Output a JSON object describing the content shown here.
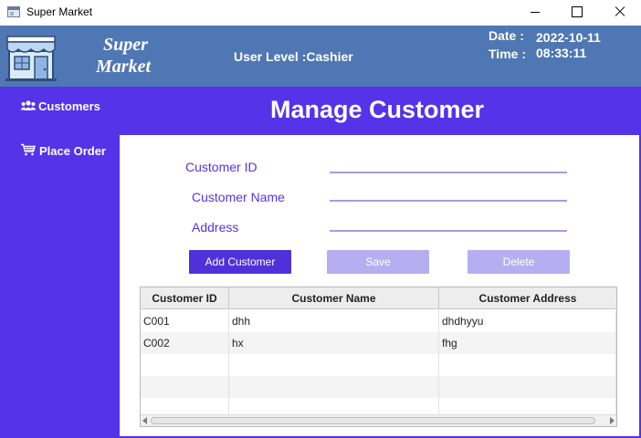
{
  "window": {
    "title": "Super Market"
  },
  "header": {
    "brand_line1": "Super",
    "brand_line2": "Market",
    "user_level": "User Level :Cashier",
    "date_label": "Date  :",
    "date_value": "2022-10-11",
    "time_label": "Time :",
    "time_value": "08:33:11"
  },
  "sidebar": {
    "items": [
      {
        "label": "Customers",
        "icon": "users-icon"
      },
      {
        "label": "Place Order",
        "icon": "cart-icon"
      }
    ]
  },
  "page": {
    "title": "Manage Customer"
  },
  "form": {
    "customer_id_label": "Customer ID",
    "customer_name_label": "Customer Name",
    "address_label": "Address",
    "customer_id_value": "",
    "customer_name_value": "",
    "address_value": ""
  },
  "buttons": {
    "add": "Add Customer",
    "save": "Save",
    "delete": "Delete"
  },
  "table": {
    "columns": [
      "Customer ID",
      "Customer Name",
      "Customer Address"
    ],
    "rows": [
      [
        "C001",
        "dhh",
        "dhdhyyu"
      ],
      [
        "C002",
        "hx",
        "fhg"
      ]
    ]
  },
  "colors": {
    "header_bg": "#4f77b3",
    "sidebar_bg": "#5433e8",
    "primary_button": "#4f31d9",
    "disabled_button": "#b7aef1",
    "label_text": "#5433e8"
  }
}
